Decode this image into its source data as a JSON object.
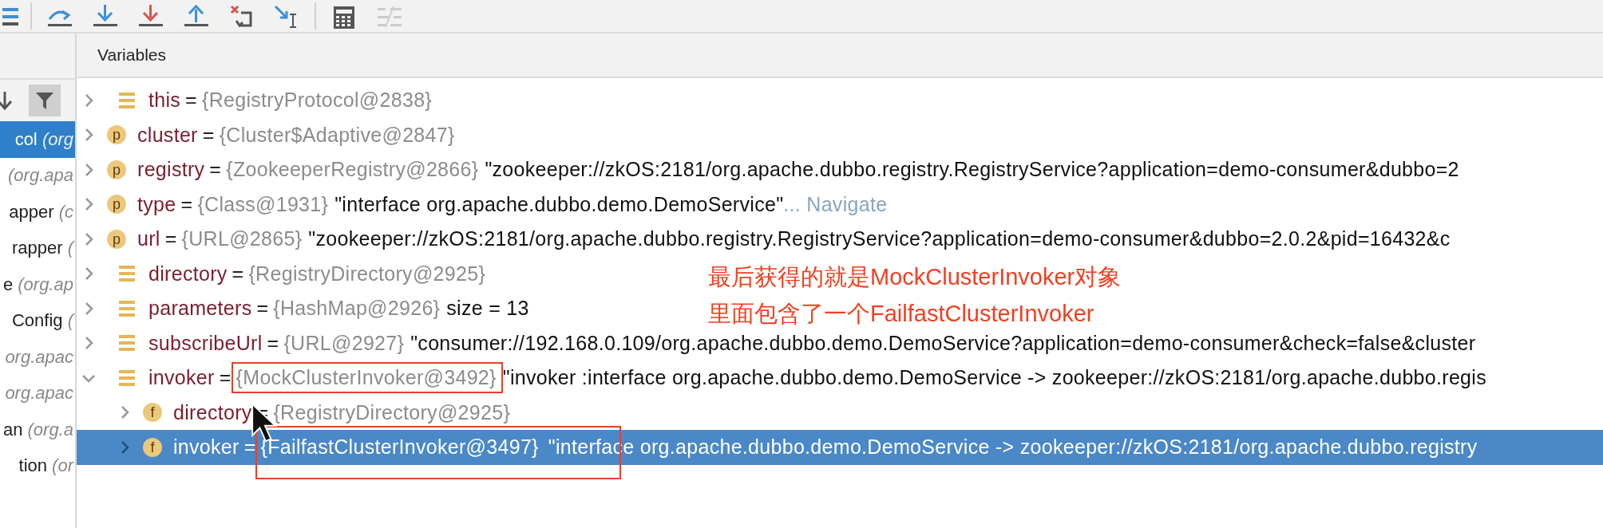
{
  "toolbar": [
    {
      "kind": "list"
    },
    {
      "kind": "divider"
    },
    {
      "kind": "step_over"
    },
    {
      "kind": "step_into"
    },
    {
      "kind": "force_step_into"
    },
    {
      "kind": "step_out"
    },
    {
      "kind": "drop_frame"
    },
    {
      "kind": "run_to_cursor"
    },
    {
      "kind": "divider"
    },
    {
      "kind": "evaluate"
    },
    {
      "kind": "trace"
    }
  ],
  "frames": {
    "filter_on": true,
    "items": [
      {
        "name": "col",
        "detail": "(org",
        "selected": true
      },
      {
        "detail": "(org.apa",
        "selected": false
      },
      {
        "name": "apper",
        "detail": "(c",
        "selected": false
      },
      {
        "name": "rapper",
        "detail": "(",
        "selected": false
      },
      {
        "name": "e",
        "detail": "(org.ap",
        "selected": false
      },
      {
        "name": "Config",
        "detail": "(",
        "selected": false
      },
      {
        "detail": "org.apac",
        "selected": false
      },
      {
        "detail": "org.apac",
        "selected": false
      },
      {
        "name": "an",
        "detail": "(org.a",
        "selected": false
      },
      {
        "name": "tion",
        "detail": "(or",
        "selected": false
      }
    ]
  },
  "variables": {
    "title": "Variables",
    "rows": [
      {
        "name": "this",
        "op": "=",
        "type": "{RegistryProtocol@2838}",
        "expanded": false,
        "selected": false
      },
      {
        "badge": "p",
        "name": "cluster",
        "op": "=",
        "type": "{Cluster$Adaptive@2847}",
        "expanded": false,
        "selected": false
      },
      {
        "badge": "p",
        "name": "registry",
        "op": "=",
        "type": "{ZookeeperRegistry@2866}",
        "value": "\"zookeeper://zkOS:2181/org.apache.dubbo.registry.RegistryService?application=demo-consumer&dubbo=2",
        "expanded": false,
        "selected": false
      },
      {
        "badge": "p",
        "name": "type",
        "op": "=",
        "type": "{Class@1931}",
        "value": "\"interface org.apache.dubbo.demo.DemoService\"",
        "link": "... Navigate",
        "expanded": false,
        "selected": false
      },
      {
        "badge": "p",
        "name": "url",
        "op": "=",
        "type": "{URL@2865}",
        "value": "\"zookeeper://zkOS:2181/org.apache.dubbo.registry.RegistryService?application=demo-consumer&dubbo=2.0.2&pid=16432&c",
        "expanded": false,
        "selected": false
      },
      {
        "name": "directory",
        "op": "=",
        "type": "{RegistryDirectory@2925}",
        "expanded": false,
        "selected": false
      },
      {
        "name": "parameters",
        "op": "=",
        "type": "{HashMap@2926}",
        "value": "size = 13",
        "expanded": false,
        "selected": false
      },
      {
        "name": "subscribeUrl",
        "op": "=",
        "type": "{URL@2927}",
        "value": "\"consumer://192.168.0.109/org.apache.dubbo.demo.DemoService?application=demo-consumer&check=false&cluster",
        "expanded": false,
        "selected": false
      },
      {
        "name": "invoker",
        "op": "=",
        "type": "{MockClusterInvoker@3492}",
        "boxed": true,
        "value": "\"invoker :interface org.apache.dubbo.demo.DemoService -> zookeeper://zkOS:2181/org.apache.dubbo.regis",
        "expanded": true,
        "selected": false,
        "children": [
          {
            "badge": "f",
            "name": "directory",
            "op": "=",
            "type": "{RegistryDirectory@2925}",
            "boxed": false,
            "expanded": false,
            "selected": false
          },
          {
            "badge": "f",
            "name": "invoker",
            "op": "=",
            "type": "{FailfastClusterInvoker@3497}",
            "boxed": true,
            "value": "\"interface org.apache.dubbo.demo.DemoService -> zookeeper://zkOS:2181/org.apache.dubbo.registry",
            "expanded": false,
            "selected": true
          }
        ]
      }
    ]
  },
  "annotation": {
    "lines": [
      "最后获得的就是MockClusterInvoker对象",
      "里面包含了一个FailfastClusterInvoker"
    ]
  }
}
